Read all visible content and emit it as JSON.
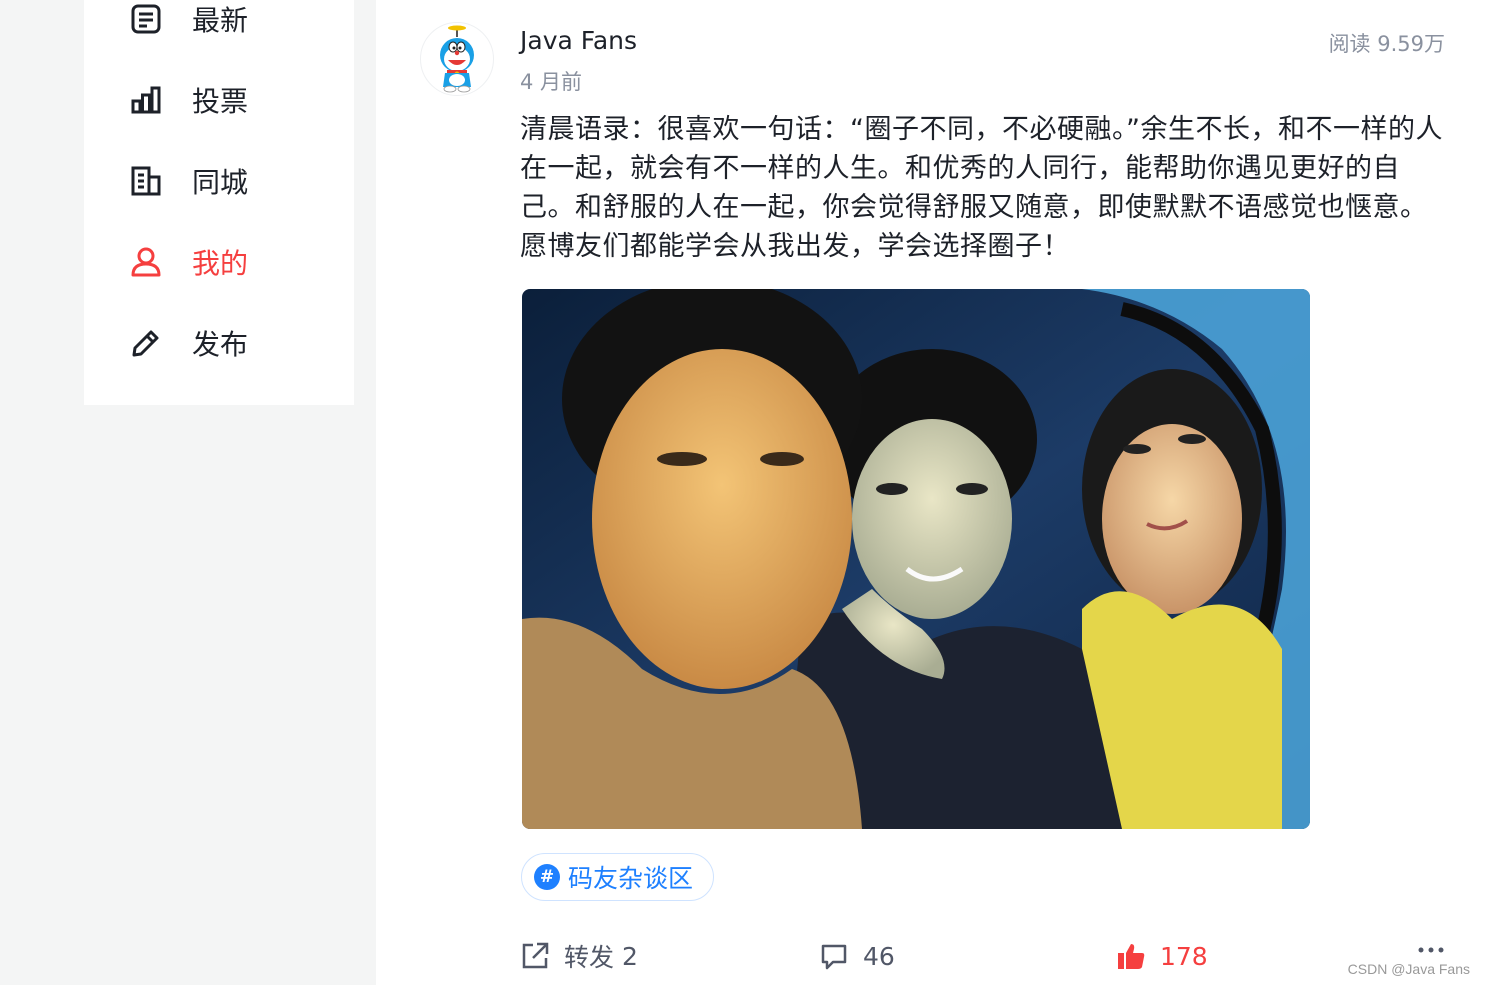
{
  "sidebar": {
    "items": [
      {
        "label": "最新",
        "icon": "news-icon",
        "active": false
      },
      {
        "label": "投票",
        "icon": "bar-chart-icon",
        "active": false
      },
      {
        "label": "同城",
        "icon": "building-icon",
        "active": false
      },
      {
        "label": "我的",
        "icon": "user-icon",
        "active": true
      },
      {
        "label": "发布",
        "icon": "pencil-icon",
        "active": false
      }
    ]
  },
  "post": {
    "author": "Java Fans",
    "time": "4 月前",
    "read_count": "阅读 9.59万",
    "text": "清晨语录：很喜欢一句话：“圈子不同，不必硬融。”余生不长，和不一样的人在一起，就会有不一样的人生。和优秀的人同行，能帮助你遇见更好的自己。和舒服的人在一起，你会觉得舒服又随意，即使默默不语感觉也惬意。愿博友们都能学会从我出发，学会选择圈子！",
    "topic": "码友杂谈区",
    "actions": {
      "share_label": "转发",
      "share_count": "2",
      "comment_count": "46",
      "like_count": "178"
    }
  },
  "colors": {
    "accent": "#f53f3f",
    "link": "#1e80ff",
    "text": "#1d2129",
    "muted": "#8a919f"
  },
  "watermark": "CSDN @Java Fans"
}
